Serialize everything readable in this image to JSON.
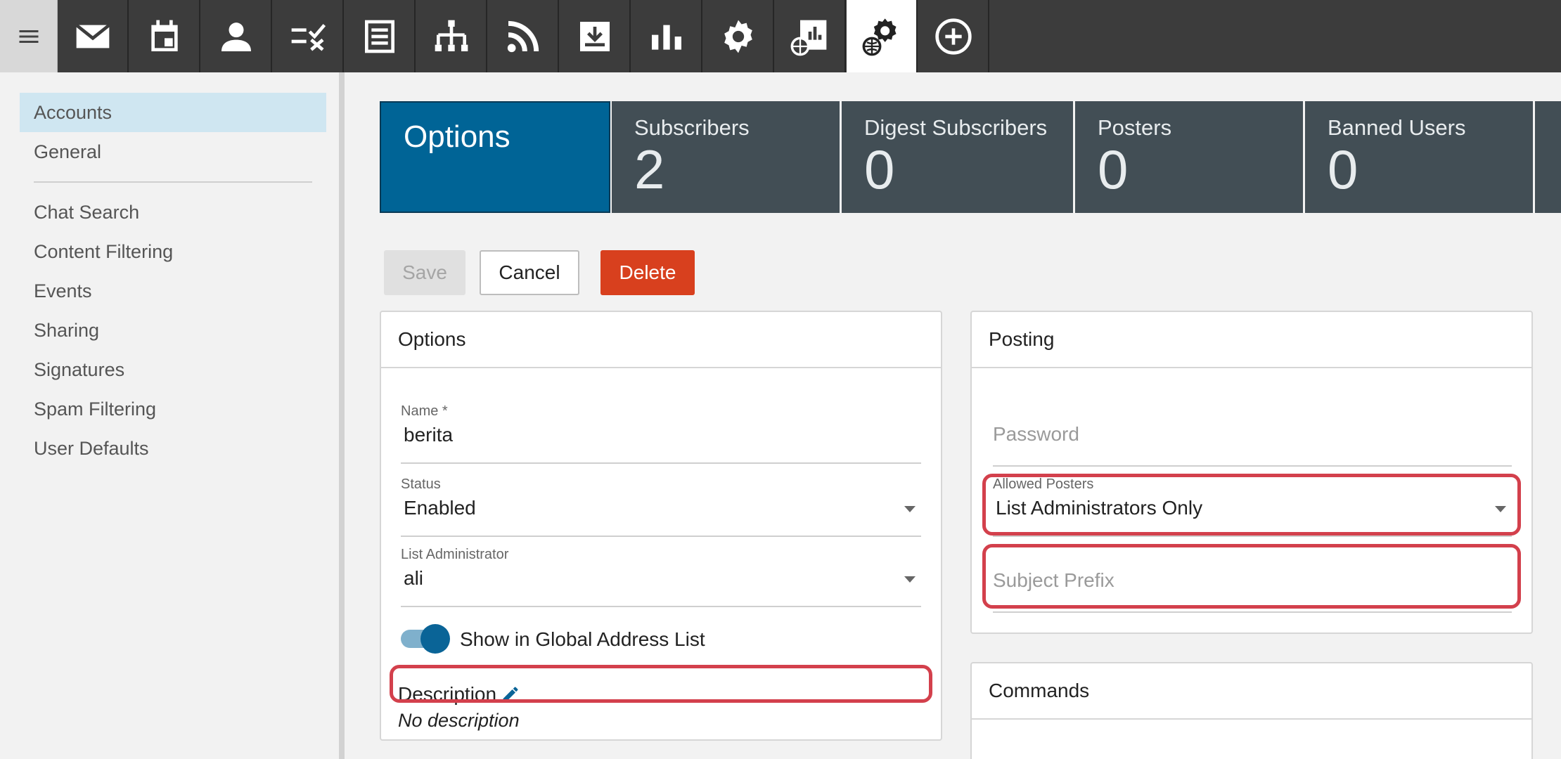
{
  "toolbar": {
    "icons": [
      "menu-icon",
      "mail-icon",
      "calendar-icon",
      "contact-icon",
      "tasks-icon",
      "notes-icon",
      "org-chart-icon",
      "rss-icon",
      "inbox-download-icon",
      "reports-icon",
      "settings-icon",
      "domain-reports-icon",
      "system-settings-icon",
      "add-circle-icon"
    ],
    "active": "system-settings-icon"
  },
  "sidebar": {
    "top_items": [
      {
        "label": "Accounts"
      },
      {
        "label": "General"
      }
    ],
    "items": [
      {
        "label": "Chat Search"
      },
      {
        "label": "Content Filtering"
      },
      {
        "label": "Events"
      },
      {
        "label": "Sharing"
      },
      {
        "label": "Signatures"
      },
      {
        "label": "Spam Filtering"
      },
      {
        "label": "User Defaults"
      }
    ]
  },
  "tabs": [
    {
      "label": "Options"
    },
    {
      "label": "Subscribers",
      "count": "2"
    },
    {
      "label": "Digest Subscribers",
      "count": "0"
    },
    {
      "label": "Posters",
      "count": "0"
    },
    {
      "label": "Banned Users",
      "count": "0"
    }
  ],
  "actions": {
    "save": "Save",
    "cancel": "Cancel",
    "delete": "Delete"
  },
  "options_panel": {
    "title": "Options",
    "name_label": "Name *",
    "name_value": "berita",
    "status_label": "Status",
    "status_value": "Enabled",
    "admin_label": "List Administrator",
    "admin_value": "ali",
    "gal_label": "Show in Global Address List",
    "gal_on": true,
    "description_label": "Description",
    "description_value": "No description"
  },
  "posting_panel": {
    "title": "Posting",
    "password_placeholder": "Password",
    "allowed_label": "Allowed Posters",
    "allowed_value": "List Administrators Only",
    "subject_placeholder": "Subject Prefix"
  },
  "commands_panel": {
    "title": "Commands"
  },
  "colors": {
    "accent": "#006496",
    "delete": "#d8401e",
    "highlight": "#d3404c",
    "tab_bg": "#424e55",
    "sidebar_selected": "#cfe6f1"
  }
}
